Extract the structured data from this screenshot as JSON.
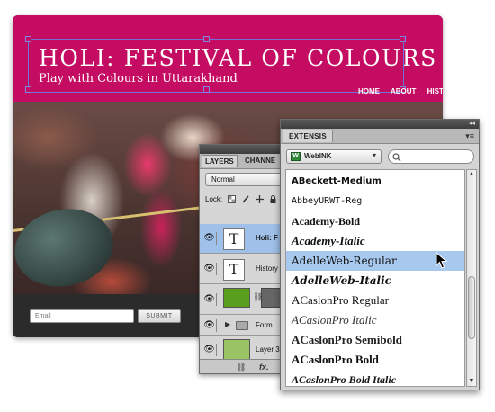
{
  "site": {
    "title": "HOLI: FESTIVAL OF COLOURS",
    "tagline": "Play with Colours in Uttarakhand",
    "nav": [
      "HOME",
      "ABOUT",
      "HIST"
    ],
    "email_placeholder": "Email",
    "submit_label": "SUBMIT",
    "colors": {
      "header": "#c50c63",
      "footer": "#2b2b2b"
    }
  },
  "layers_panel": {
    "tabs": [
      "LAYERS",
      "CHANNE"
    ],
    "blend_mode": "Normal",
    "lock_label": "Lock:",
    "layers": [
      {
        "name": "Holi: F",
        "kind": "text",
        "selected": true
      },
      {
        "name": "History",
        "kind": "text",
        "selected": false
      },
      {
        "name": "",
        "kind": "shape-with-mask",
        "selected": false
      },
      {
        "name": "Form",
        "kind": "group",
        "selected": false
      },
      {
        "name": "Layer 3",
        "kind": "image",
        "selected": false
      }
    ],
    "bottom_glyphs": {
      "link": "⛓",
      "fx": "fx."
    }
  },
  "extensis_panel": {
    "tab_label": "EXTENSIS",
    "source_select": "WebINK",
    "source_logo": "W",
    "search_placeholder": "",
    "fonts": [
      {
        "name": "ABeckett-Medium",
        "selected": false
      },
      {
        "name": "AbbeyURWT-Reg",
        "selected": false
      },
      {
        "name": "Academy-Bold",
        "selected": false
      },
      {
        "name": "Academy-Italic",
        "selected": false
      },
      {
        "name": "AdelleWeb-Regular",
        "selected": true
      },
      {
        "name": "AdelleWeb-Italic",
        "selected": false
      },
      {
        "name": "ACaslonPro Regular",
        "selected": false
      },
      {
        "name": "ACaslonPro Italic",
        "selected": false
      },
      {
        "name": "ACaslonPro Semibold",
        "selected": false
      },
      {
        "name": "ACaslonPro Bold",
        "selected": false
      },
      {
        "name": "ACaslonPro Bold Italic",
        "selected": false
      }
    ],
    "colors": {
      "selection": "#a8c9ee"
    }
  }
}
